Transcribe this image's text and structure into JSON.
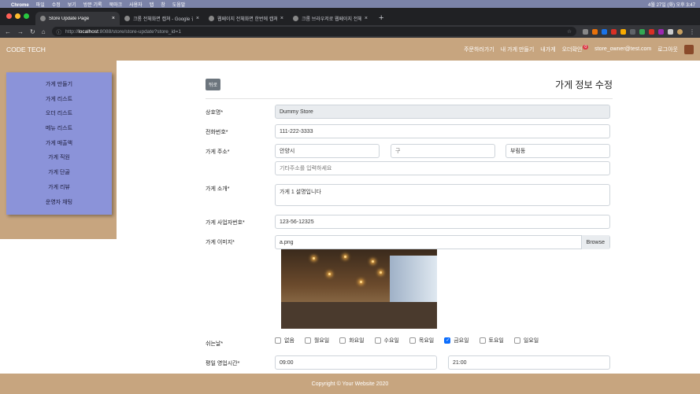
{
  "mac": {
    "menu": [
      "Chrome",
      "파일",
      "수정",
      "보기",
      "방문 기록",
      "북마크",
      "사용자",
      "탭",
      "창",
      "도움말"
    ],
    "clock": "4월 27일 (화) 오후 3:47"
  },
  "tabs": [
    {
      "label": "Store Update Page",
      "active": true
    },
    {
      "label": "크롬 전체화면 캡쳐 - Google 검색",
      "active": false
    },
    {
      "label": "웹페이지 전체화면 한번에 캡쳐하기(…",
      "active": false
    },
    {
      "label": "크롬 브라우저로 웹페이지 전체를 한…",
      "active": false
    }
  ],
  "address": {
    "prefix": "http://",
    "host": "localhost",
    "rest": ":8088/store/store-update?store_id=1"
  },
  "navbar": {
    "brand": "CODE TECH",
    "links": [
      "주문하러가기",
      "내 가게 만들기",
      "내가게"
    ],
    "orders": "오더확인",
    "orders_badge": "0",
    "email": "store_owner@test.com",
    "logout": "로그아웃"
  },
  "sidebar": {
    "items": [
      "가게 만들기",
      "가게 리스트",
      "오더 리스트",
      "메뉴 리스트",
      "가게 매출액",
      "가게 직원",
      "가게 단골",
      "가게 리뷰",
      "운영자 채팅"
    ]
  },
  "page": {
    "back": "뒤로",
    "title": "가게 정보 수정"
  },
  "form": {
    "name_label": "상호명*",
    "name_value": "Dummy Store",
    "phone_label": "전화번호*",
    "phone_value": "111-222-3333",
    "address_label": "가게 주소*",
    "city": "안양시",
    "district": "구",
    "dong": "부림동",
    "address_detail_placeholder": "기타주소를 입력하세요",
    "intro_label": "가게 소개*",
    "intro_value": "가게 1 설명입니다",
    "biz_label": "가게 사업자번호*",
    "biz_value": "123-56-12325",
    "image_label": "가게 이미지*",
    "image_file": "a.png",
    "browse": "Browse",
    "holiday_label": "쉬는날*",
    "days": [
      {
        "label": "없음",
        "checked": false
      },
      {
        "label": "월요일",
        "checked": false
      },
      {
        "label": "화요일",
        "checked": false
      },
      {
        "label": "수요일",
        "checked": false
      },
      {
        "label": "목요일",
        "checked": false
      },
      {
        "label": "금요일",
        "checked": true
      },
      {
        "label": "토요일",
        "checked": false
      },
      {
        "label": "일요일",
        "checked": false
      }
    ],
    "hours_label": "평일 영업시간*",
    "open": "09:00",
    "close": "21:00"
  },
  "footer": "Copyright © Your Website 2020"
}
